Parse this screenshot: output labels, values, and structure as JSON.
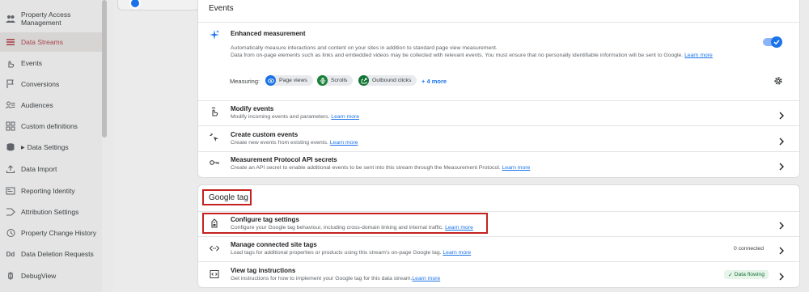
{
  "sidebar": {
    "items": [
      {
        "label": "Property Access Management",
        "icon": "people-icon"
      },
      {
        "label": "Data Streams",
        "icon": "streams-icon",
        "active": true
      },
      {
        "label": "Events",
        "icon": "touch-icon"
      },
      {
        "label": "Conversions",
        "icon": "flag-icon"
      },
      {
        "label": "Audiences",
        "icon": "audience-icon"
      },
      {
        "label": "Custom definitions",
        "icon": "custom-definitions-icon"
      },
      {
        "label": "Data Settings",
        "icon": "database-icon",
        "caret": "▶"
      },
      {
        "label": "Data Import",
        "icon": "upload-icon"
      },
      {
        "label": "Reporting Identity",
        "icon": "identity-icon"
      },
      {
        "label": "Attribution Settings",
        "icon": "attribution-icon"
      },
      {
        "label": "Property Change History",
        "icon": "history-icon"
      },
      {
        "label": "Data Deletion Requests",
        "icon": "dd-icon"
      },
      {
        "label": "DebugView",
        "icon": "debug-icon"
      }
    ]
  },
  "events_section": {
    "title": "Events",
    "enhanced": {
      "title": "Enhanced measurement",
      "desc_line1": "Automatically measure interactions and content on your sites in addition to standard page view measurement.",
      "desc_line2": "Data from on-page elements such as links and embedded videos may be collected with relevant events. You must ensure that no personally identifiable information will be sent to Google.",
      "learn_more": "Learn more",
      "measuring_label": "Measuring:",
      "chips": [
        "Page views",
        "Scrolls",
        "Outbound clicks"
      ],
      "more": "+ 4 more",
      "enabled": true
    },
    "rows": [
      {
        "title": "Modify events",
        "desc": "Modify incoming events and parameters.",
        "link": "Learn more"
      },
      {
        "title": "Create custom events",
        "desc": "Create new events from existing events.",
        "link": "Learn more"
      },
      {
        "title": "Measurement Protocol API secrets",
        "desc": "Create an API secret to enable additional events to be sent into this stream through the Measurement Protocol.",
        "link": "Learn more"
      }
    ]
  },
  "google_tag_section": {
    "title": "Google tag",
    "rows": [
      {
        "title": "Configure tag settings",
        "desc": "Configure your Google tag behaviour, including cross-domain linking and internal traffic.",
        "link": "Learn more"
      },
      {
        "title": "Manage connected site tags",
        "desc": "Load tags for additional properties or products using this stream's on-page Google tag.",
        "link": "Learn more",
        "status": "0 connected"
      },
      {
        "title": "View tag instructions",
        "desc": "Get instructions for how to implement your Google tag for this data stream.",
        "link": "Learn more",
        "status": "Data flowing",
        "status_icon": "✓"
      }
    ]
  },
  "colors": {
    "accent": "#1a73e8",
    "highlight": "#c5221f",
    "active_nav": "#a8464a",
    "success": "#137333"
  }
}
